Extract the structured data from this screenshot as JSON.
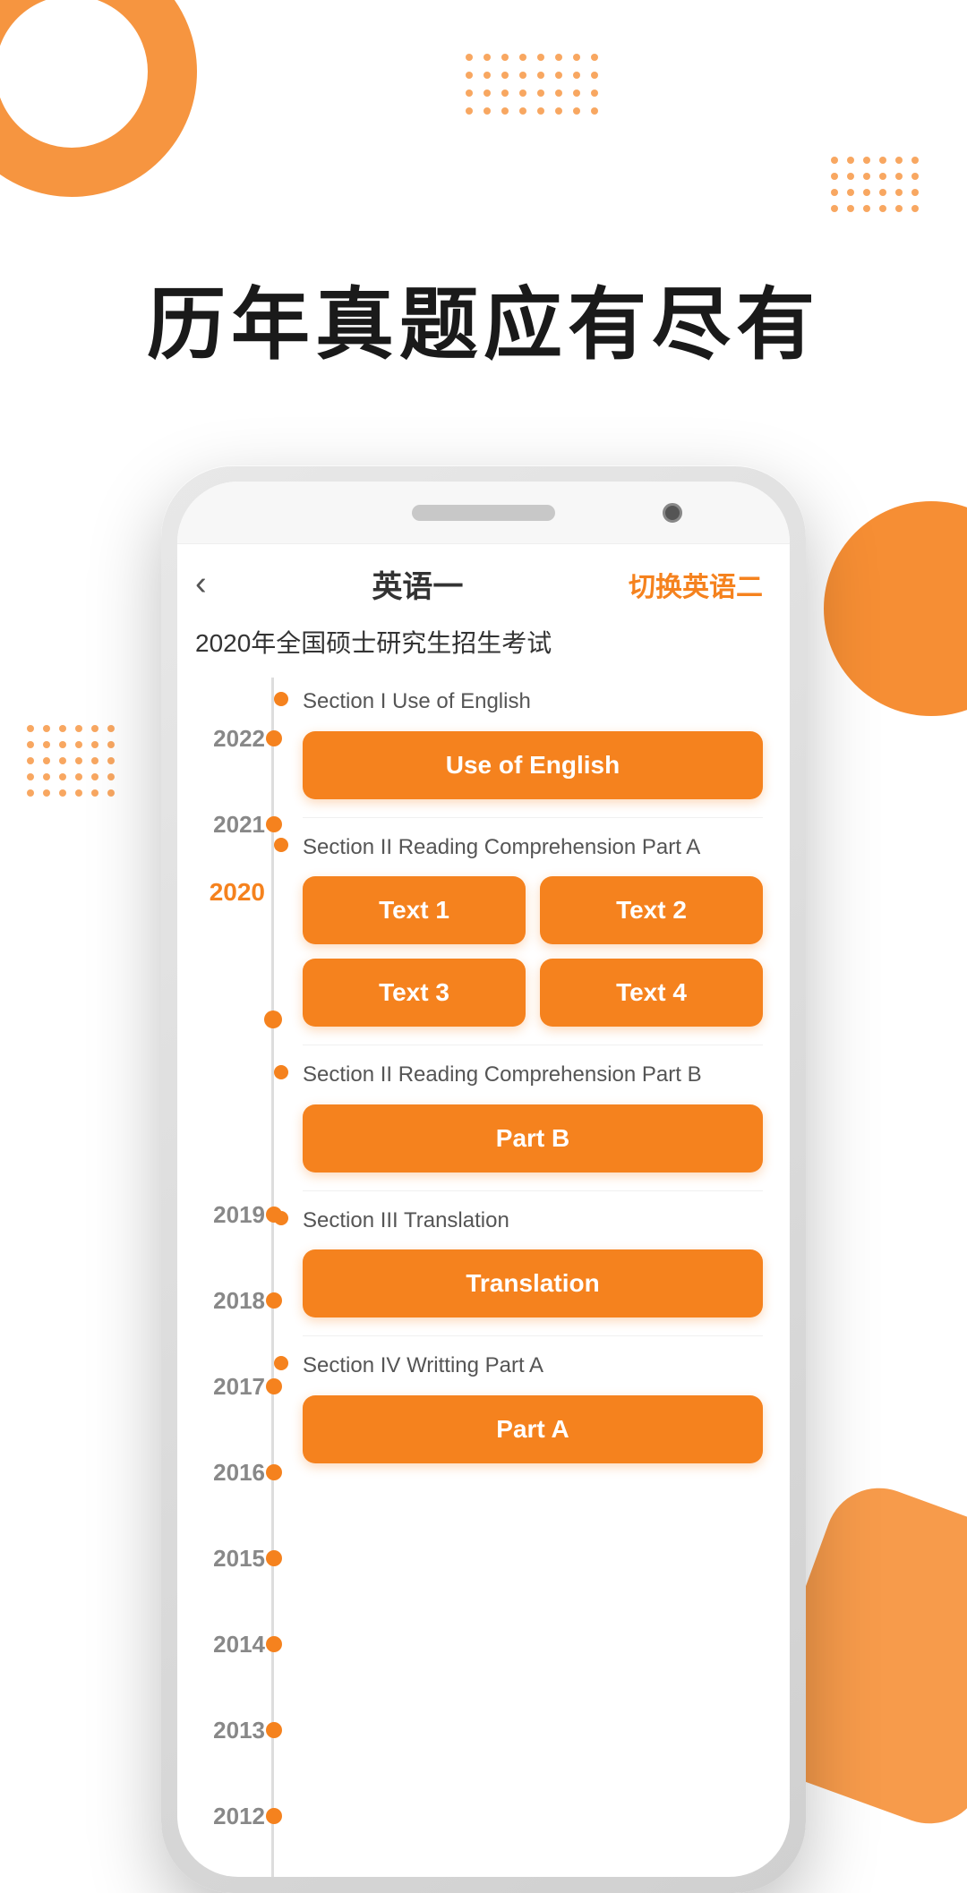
{
  "hero": {
    "title": "历年真题应有尽有"
  },
  "phone": {
    "header": {
      "back_label": "‹",
      "title": "英语一",
      "switch_label": "切换英语二"
    },
    "exam_title": "2020年全国硕士研究生招生考试",
    "sections": [
      {
        "id": "section1",
        "label": "Section I Use of English",
        "buttons": [
          "Use of English"
        ]
      },
      {
        "id": "section2a",
        "label": "Section II Reading Comprehension Part A",
        "buttons": [
          "Text 1",
          "Text 2",
          "Text 3",
          "Text 4"
        ]
      },
      {
        "id": "section2b",
        "label": "Section II Reading Comprehension Part B",
        "buttons": [
          "Part B"
        ]
      },
      {
        "id": "section3",
        "label": "Section III Translation",
        "buttons": [
          "Translation"
        ]
      },
      {
        "id": "section4",
        "label": "Section IV Writting Part A",
        "buttons": [
          "Part A"
        ]
      }
    ],
    "years": [
      "2022",
      "2021",
      "2020",
      "2019",
      "2018",
      "2017",
      "2016",
      "2015",
      "2014",
      "2013",
      "2012"
    ],
    "active_year": "2020"
  },
  "colors": {
    "orange": "#F5821E",
    "dark": "#1a1a1a",
    "gray": "#888888",
    "white": "#ffffff"
  }
}
